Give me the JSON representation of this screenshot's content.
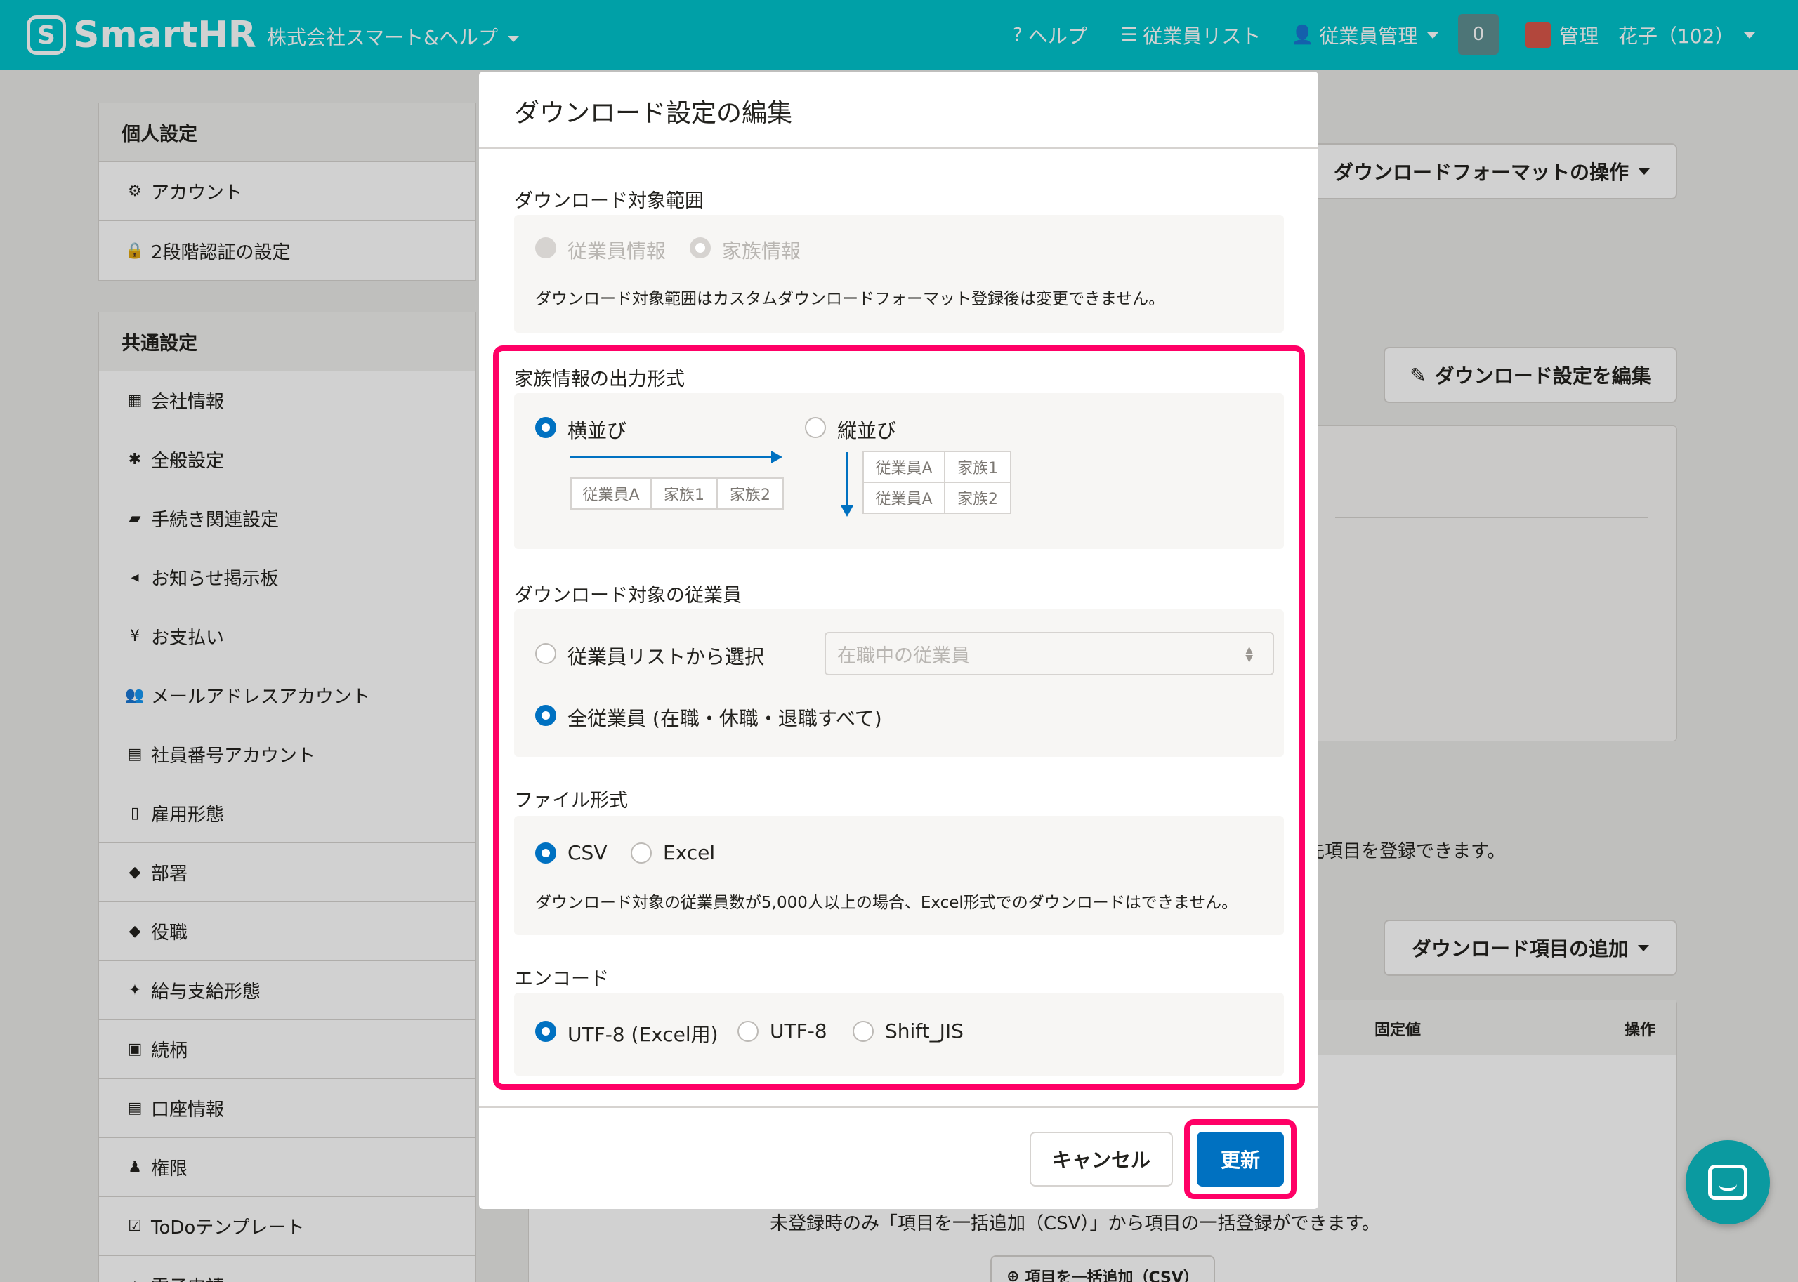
{
  "header": {
    "logo_text": "SmartHR",
    "company": "株式会社スマート&ヘルプ",
    "help": "ヘルプ",
    "employee_list": "従業員リスト",
    "employee_manage": "従業員管理",
    "notification_count": "0",
    "user_name": "管理　花子（102）"
  },
  "sidebar": {
    "personal_title": "個人設定",
    "personal_items": [
      "アカウント",
      "2段階認証の設定"
    ],
    "common_title": "共通設定",
    "common_items": [
      "会社情報",
      "全般設定",
      "手続き関連設定",
      "お知らせ掲示板",
      "お支払い",
      "メールアドレスアカウント",
      "社員番号アカウント",
      "雇用形態",
      "部署",
      "役職",
      "給与支給形態",
      "続柄",
      "口座情報",
      "権限",
      "ToDoテンプレート",
      "電子申請"
    ]
  },
  "background": {
    "format_ops_button": "ダウンロードフォーマットの操作",
    "edit_settings_button": "ダウンロード設定を編集",
    "items_text": "先項目を登録できます。",
    "add_items_button": "ダウンロード項目の追加",
    "col_fixed": "固定値",
    "col_ops": "操作",
    "bulk_text": "未登録時のみ「項目を一括追加（CSV）」から項目の一括登録ができます。",
    "bulk_button": "項目を一括追加（CSV）"
  },
  "modal": {
    "title": "ダウンロード設定の編集",
    "scope": {
      "label": "ダウンロード対象範囲",
      "opt1": "従業員情報",
      "opt2": "家族情報",
      "note": "ダウンロード対象範囲はカスタムダウンロードフォーマット登録後は変更できません。"
    },
    "family_format": {
      "label": "家族情報の出力形式",
      "horizontal": "横並び",
      "vertical": "縦並び",
      "cell_employee": "従業員A",
      "cell_family1": "家族1",
      "cell_family2": "家族2"
    },
    "target_employees": {
      "label": "ダウンロード対象の従業員",
      "opt_list": "従業員リストから選択",
      "select_placeholder": "在職中の従業員",
      "opt_all": "全従業員 (在職・休職・退職すべて)"
    },
    "file_format": {
      "label": "ファイル形式",
      "csv": "CSV",
      "excel": "Excel",
      "note": "ダウンロード対象の従業員数が5,000人以上の場合、Excel形式でのダウンロードはできません。"
    },
    "encoding": {
      "label": "エンコード",
      "utf8_excel": "UTF-8 (Excel用)",
      "utf8": "UTF-8",
      "sjis": "Shift_JIS"
    },
    "cancel": "キャンセル",
    "update": "更新"
  },
  "colors": {
    "brand": "#00c4cc",
    "primary": "#0071c1",
    "highlight": "#ff0066"
  }
}
